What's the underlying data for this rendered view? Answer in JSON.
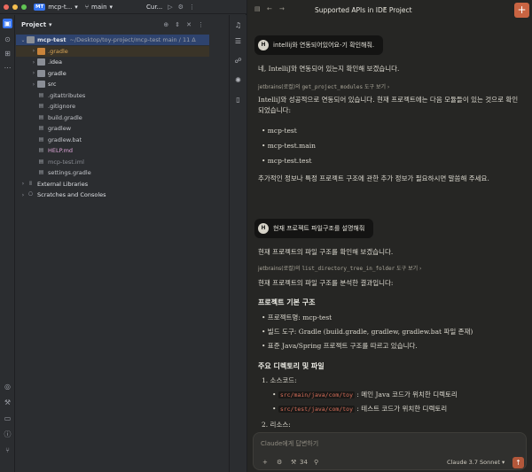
{
  "ide": {
    "titlebar": {
      "project_badge": "MT",
      "project_name": "mcp-t...",
      "branch": "main",
      "run_config": "Cur..."
    },
    "panel_title": "Project",
    "tree": [
      {
        "label": "mcp-test",
        "extra": "~/Desktop/toy-project/mcp-test main / 11 Δ",
        "level": 0,
        "kind": "folder",
        "expanded": true
      },
      {
        "label": ".gradle",
        "level": 1,
        "kind": "folder-orange",
        "expanded": false
      },
      {
        "label": ".idea",
        "level": 1,
        "kind": "folder",
        "expanded": false
      },
      {
        "label": "gradle",
        "level": 1,
        "kind": "folder",
        "expanded": false
      },
      {
        "label": "src",
        "level": 1,
        "kind": "folder",
        "expanded": false
      },
      {
        "label": ".gitattributes",
        "level": 1,
        "kind": "file"
      },
      {
        "label": ".gitignore",
        "level": 1,
        "kind": "file"
      },
      {
        "label": "build.gradle",
        "level": 1,
        "kind": "file"
      },
      {
        "label": "gradlew",
        "level": 1,
        "kind": "file"
      },
      {
        "label": "gradlew.bat",
        "level": 1,
        "kind": "file"
      },
      {
        "label": "HELP.md",
        "level": 1,
        "kind": "file"
      },
      {
        "label": "mcp-test.iml",
        "level": 1,
        "kind": "file"
      },
      {
        "label": "settings.gradle",
        "level": 1,
        "kind": "file"
      },
      {
        "label": "External Libraries",
        "level": 0,
        "kind": "lib",
        "expanded": false
      },
      {
        "label": "Scratches and Consoles",
        "level": 0,
        "kind": "scratch",
        "expanded": false
      }
    ]
  },
  "chat": {
    "title": "Supported APIs in IDE Project",
    "new_chat_icon": "+",
    "messages": {
      "user1": "intellij와 연동되어있어요-기 확인해줘.",
      "reply1_p1": "네, IntelliJ와 연동되어 있는지 확인해 보겠습니다.",
      "tool1_prefix": "jetbrains(로컬)의",
      "tool1_name": "get_project_modules",
      "tool1_suffix": "도구 보기",
      "reply1_p2": "IntelliJ와 성공적으로 연동되어 있습니다. 현재 프로젝트에는 다음 모듈들이 있는 것으로 확인되었습니다:",
      "modules": [
        "mcp-test",
        "mcp-test.main",
        "mcp-test.test"
      ],
      "reply1_p3": "추가적인 정보나 특정 프로젝트 구조에 관한 추가 정보가 필요하시면 말씀해 주세요.",
      "user2": "현재 프로젝트 파일구조를 설명해줘",
      "reply2_p1": "현재 프로젝트의 파일 구조를 확인해 보겠습니다.",
      "tool2_prefix": "jetbrains(로컬)의",
      "tool2_name": "list_directory_tree_in_folder",
      "tool2_suffix": "도구 보기",
      "reply2_p2": "현재 프로젝트의 파일 구조를 분석한 결과입니다:",
      "heading1": "프로젝트 기본 구조",
      "basic_items": [
        "프로젝트명: mcp-test",
        "빌드 도구: Gradle (build.gradle, gradlew, gradlew.bat 파일 존재)",
        "표준 Java/Spring 프로젝트 구조를 따르고 있습니다."
      ],
      "heading2": "주요 디렉토리 및 파일",
      "section1": "1. 소스코드:",
      "src_items": [
        {
          "path": "src/main/java/com/toy",
          "desc": ": 메인 Java 코드가 위치한 디렉토리"
        },
        {
          "path": "src/test/java/com/toy",
          "desc": ": 테스트 코드가 위치한 디렉토리"
        }
      ],
      "section2": "2. 리소스:"
    },
    "composer": {
      "placeholder": "Claude에게 답변하기",
      "tool_count": "34",
      "model": "Claude 3.7 Sonnet ▾"
    }
  },
  "colors": {
    "accent_ide": "#3574f0",
    "accent_claude": "#c96442",
    "code_text": "#d96f5a"
  }
}
